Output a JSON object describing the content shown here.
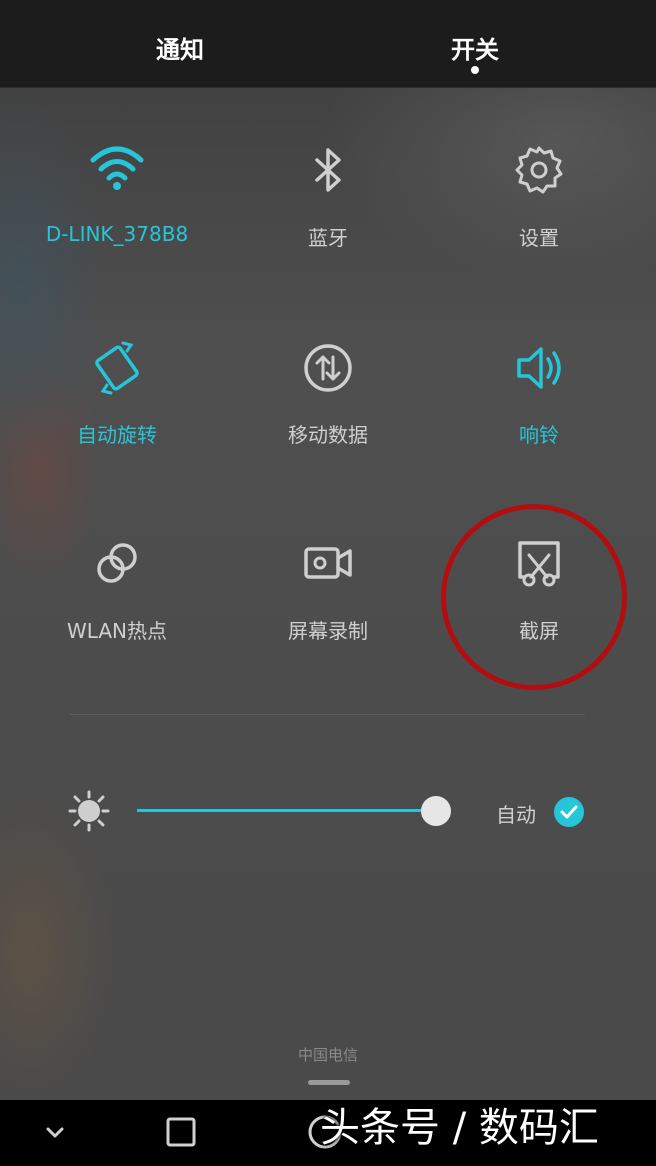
{
  "tabs": {
    "notify_label": "通知",
    "switch_label": "开关"
  },
  "tiles": [
    {
      "label": "D-LINK_378B8",
      "icon": "wifi-icon",
      "active": true
    },
    {
      "label": "蓝牙",
      "icon": "bluetooth-icon",
      "active": false
    },
    {
      "label": "设置",
      "icon": "gear-icon",
      "active": false
    },
    {
      "label": "自动旋转",
      "icon": "rotate-icon",
      "active": true
    },
    {
      "label": "移动数据",
      "icon": "mobile-data-icon",
      "active": false
    },
    {
      "label": "响铃",
      "icon": "speaker-icon",
      "active": true
    },
    {
      "label": "WLAN热点",
      "icon": "hotspot-icon",
      "active": false
    },
    {
      "label": "屏幕录制",
      "icon": "screen-record-icon",
      "active": false
    },
    {
      "label": "截屏",
      "icon": "screenshot-icon",
      "active": false
    }
  ],
  "brightness": {
    "level": 0.95,
    "auto_label": "自动",
    "auto_checked": true
  },
  "carrier": "中国电信",
  "watermark": "头条号 / 数码汇",
  "colors": {
    "accent": "#26c6da",
    "inactive": "#cfcfcf",
    "annotation": "#b40d10"
  }
}
